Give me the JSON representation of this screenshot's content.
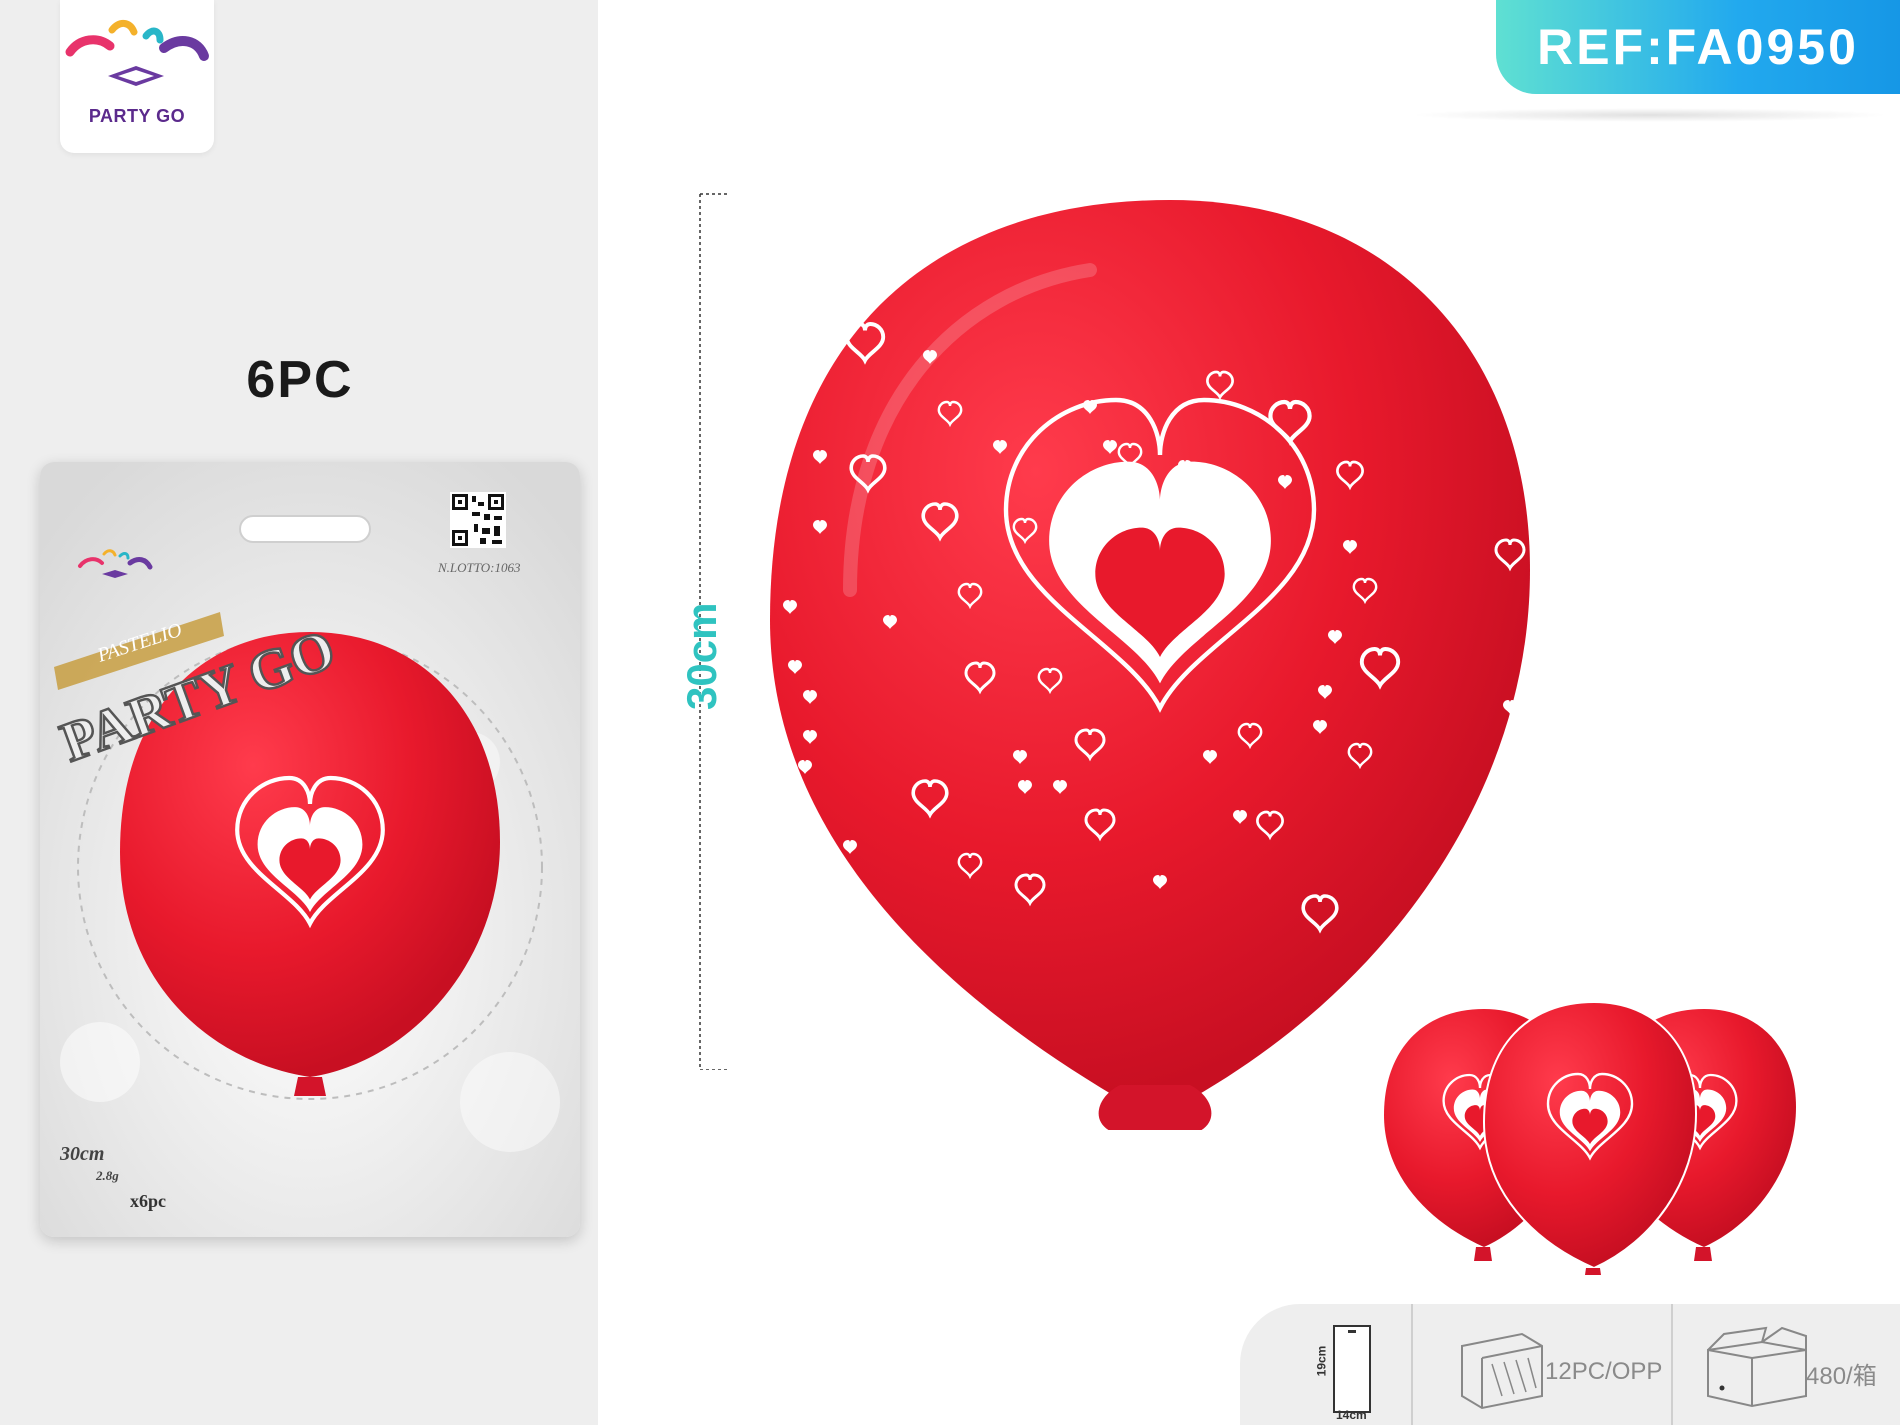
{
  "brand": {
    "name": "PARTY GO"
  },
  "product": {
    "count_label": "6PC",
    "reference": "REF:FA0950",
    "size_label": "30cm"
  },
  "package": {
    "lot": "N.LOTTO:1063",
    "series": "PASTELIO",
    "title": "PARTY GO",
    "size": "30cm",
    "weight": "2.8g",
    "quantity": "x6pc"
  },
  "footer": {
    "box_width": "14cm",
    "box_height": "19cm",
    "inner_pack": "12PC/OPP",
    "carton": "480/箱"
  },
  "colors": {
    "balloon": "#e8192c",
    "accent_teal": "#2fc3c0",
    "ref_gradient_start": "#5fe0d2",
    "ref_gradient_end": "#1697e6",
    "brand_purple": "#5b2a8c"
  }
}
